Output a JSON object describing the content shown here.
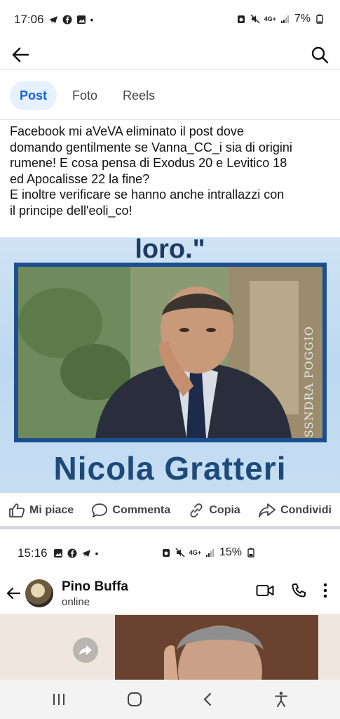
{
  "status_bar": {
    "time": "17:06",
    "battery": "7%",
    "network": "4G+"
  },
  "top_bar": {
    "back_icon": "arrow-left-icon",
    "search_icon": "search-icon"
  },
  "tabs": [
    {
      "label": "Post",
      "active": true
    },
    {
      "label": "Foto",
      "active": false
    },
    {
      "label": "Reels",
      "active": false
    }
  ],
  "post": {
    "text_lines": [
      "Facebook mi aVeVA eliminato il post dove",
      "domando gentilmente se Vanna_CC_i sia di origini",
      "rumene! E cosa pensa di Exodus 20 e Levitico 18",
      "ed Apocalisse 22 la fine?",
      "E inoltre verificare se hanno anche intrallazzi con",
      "il principe dell'eoli_co!"
    ],
    "image": {
      "quote_text": "loro.\"",
      "name_text": "Nicola Gratteri",
      "watermark": "ALESSNDRA POGGIO"
    }
  },
  "actions": [
    {
      "label": "Mi piace",
      "icon": "thumbs-up-icon"
    },
    {
      "label": "Commenta",
      "icon": "comment-icon"
    },
    {
      "label": "Copia",
      "icon": "link-icon"
    },
    {
      "label": "Condividi",
      "icon": "share-icon"
    }
  ],
  "embedded_screenshot": {
    "status_time": "15:16",
    "battery": "15%",
    "network": "4G+",
    "contact_name": "Pino Buffa",
    "contact_status": "online"
  },
  "colors": {
    "accent": "#1565d8",
    "tab_active_bg": "#e7f0fd",
    "image_title": "#1e4a7a"
  }
}
